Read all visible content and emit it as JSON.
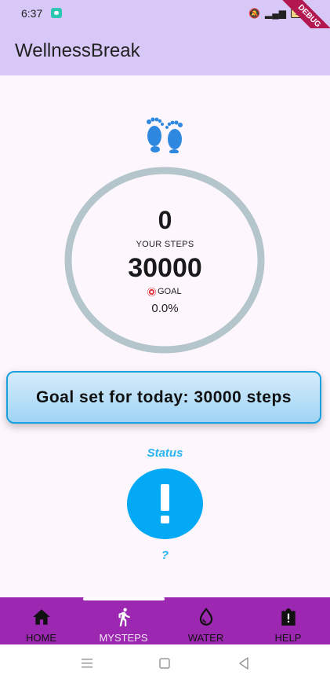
{
  "status_bar": {
    "time": "6:37",
    "battery": "10",
    "debug_banner": "DEBUG"
  },
  "app_bar": {
    "title": "WellnessBreak"
  },
  "steps": {
    "icon": "footprints-icon",
    "current": "0",
    "current_label": "YOUR STEPS",
    "goal": "30000",
    "goal_label": "GOAL",
    "percent": "0.0%",
    "progress_fraction": 0.0
  },
  "goal_banner": {
    "text": "Goal set for today: 30000 steps"
  },
  "status": {
    "title": "Status",
    "icon": "exclamation-icon",
    "value": "?"
  },
  "bottom_nav": {
    "items": [
      {
        "label": "HOME",
        "icon": "home-icon"
      },
      {
        "label": "MYSTEPS",
        "icon": "walking-icon",
        "active": true
      },
      {
        "label": "WATER",
        "icon": "water-drop-icon"
      },
      {
        "label": "HELP",
        "icon": "help-icon"
      }
    ]
  },
  "colors": {
    "app_bar": "#d8c8f8",
    "nav_bar": "#9c27b0",
    "accent_blue": "#03a9f4",
    "ring": "#b4c5cb"
  }
}
